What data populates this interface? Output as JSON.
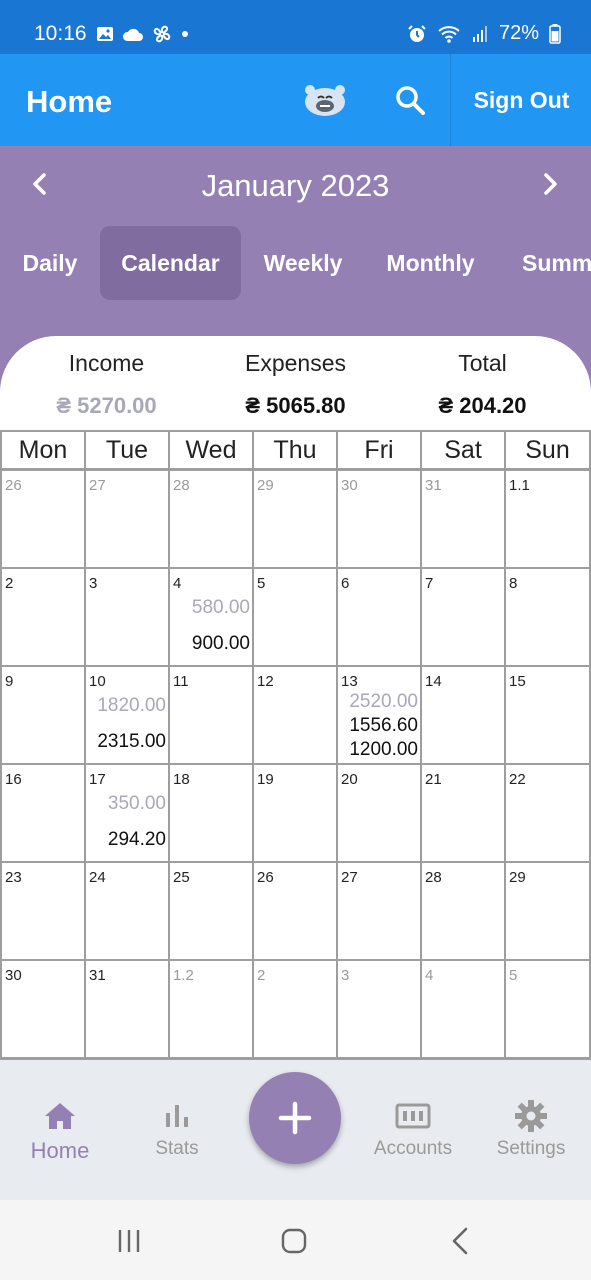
{
  "status_bar": {
    "time": "10:16",
    "battery": "72%"
  },
  "app_bar": {
    "title": "Home",
    "sign_out": "Sign Out"
  },
  "month_nav": {
    "label": "January 2023"
  },
  "tabs": [
    "Daily",
    "Calendar",
    "Weekly",
    "Monthly",
    "Summary"
  ],
  "active_tab": "Calendar",
  "summary": {
    "income_label": "Income",
    "income_value": "₴ 5270.00",
    "expenses_label": "Expenses",
    "expenses_value": "₴ 5065.80",
    "total_label": "Total",
    "total_value": "₴ 204.20"
  },
  "weekdays": [
    "Mon",
    "Tue",
    "Wed",
    "Thu",
    "Fri",
    "Sat",
    "Sun"
  ],
  "weeks": [
    [
      {
        "d": "26",
        "o": true
      },
      {
        "d": "27",
        "o": true
      },
      {
        "d": "28",
        "o": true
      },
      {
        "d": "29",
        "o": true
      },
      {
        "d": "30",
        "o": true
      },
      {
        "d": "31",
        "o": true
      },
      {
        "d": "1.1"
      }
    ],
    [
      {
        "d": "2"
      },
      {
        "d": "3"
      },
      {
        "d": "4",
        "inc": "580.00",
        "exp": [
          "900.00"
        ]
      },
      {
        "d": "5"
      },
      {
        "d": "6"
      },
      {
        "d": "7"
      },
      {
        "d": "8"
      }
    ],
    [
      {
        "d": "9"
      },
      {
        "d": "10",
        "inc": "1820.00",
        "exp": [
          "2315.00"
        ]
      },
      {
        "d": "11"
      },
      {
        "d": "12"
      },
      {
        "d": "13",
        "inc": "2520.00",
        "exp": [
          "1556.60",
          "1200.00"
        ]
      },
      {
        "d": "14"
      },
      {
        "d": "15"
      }
    ],
    [
      {
        "d": "16"
      },
      {
        "d": "17",
        "inc": "350.00",
        "exp": [
          "294.20"
        ]
      },
      {
        "d": "18"
      },
      {
        "d": "19"
      },
      {
        "d": "20"
      },
      {
        "d": "21"
      },
      {
        "d": "22"
      }
    ],
    [
      {
        "d": "23"
      },
      {
        "d": "24"
      },
      {
        "d": "25"
      },
      {
        "d": "26"
      },
      {
        "d": "27"
      },
      {
        "d": "28"
      },
      {
        "d": "29"
      }
    ],
    [
      {
        "d": "30"
      },
      {
        "d": "31"
      },
      {
        "d": "1.2",
        "o": true
      },
      {
        "d": "2",
        "o": true
      },
      {
        "d": "3",
        "o": true
      },
      {
        "d": "4",
        "o": true
      },
      {
        "d": "5",
        "o": true
      }
    ]
  ],
  "bottom_nav": [
    {
      "label": "Home",
      "icon": "home-icon",
      "active": true
    },
    {
      "label": "Stats",
      "icon": "stats-icon"
    },
    {
      "label": "Accounts",
      "icon": "accounts-icon"
    },
    {
      "label": "Settings",
      "icon": "settings-icon"
    }
  ],
  "colors": {
    "status_bar": "#1976d2",
    "app_bar": "#2196f3",
    "accent_purple": "#9480b3",
    "income_grey": "#a8a8b8"
  }
}
